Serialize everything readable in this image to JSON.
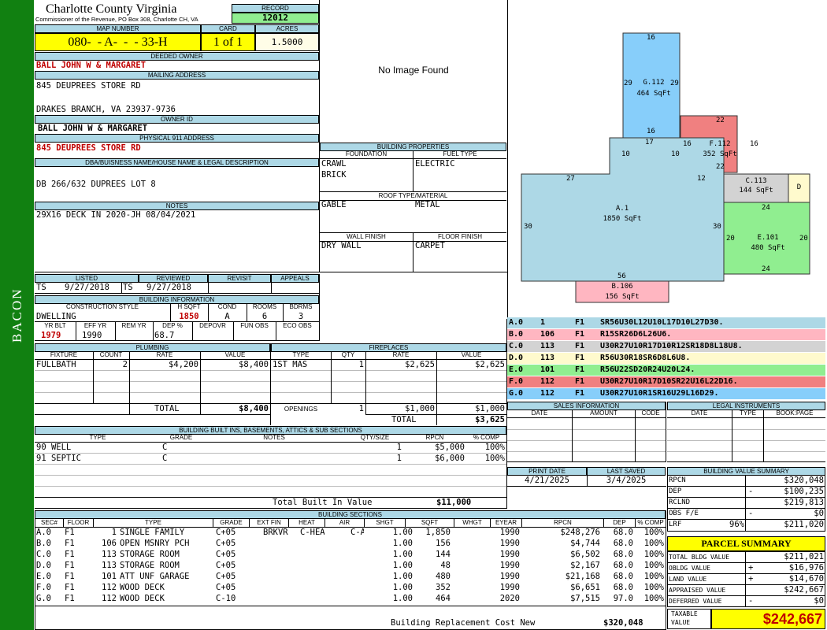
{
  "sidebar": {
    "label": "BACON"
  },
  "header": {
    "county": "Charlotte County Virginia",
    "commissioner": "Commissioner of the Revenue, PO Box 308, Charlotte CH, VA",
    "record_label": "RECORD",
    "record": "12012",
    "map_label": "MAP NUMBER",
    "map_number": "080-  - A-  -  - 33-H",
    "card_label": "CARD",
    "card": "1 of 1",
    "acres_label": "ACRES",
    "acres": "1.5000"
  },
  "owner": {
    "deeded_label": "DEEDED OWNER",
    "deeded": "BALL JOHN W & MARGARET",
    "mailing_label": "MAILING ADDRESS",
    "mail1": "845 DEUPREES STORE RD",
    "mail2": "DRAKES BRANCH, VA 23937-9736",
    "owner_id_label": "OWNER ID",
    "owner_id": "BALL JOHN W & MARGARET",
    "phys_label": "PHYSICAL 911 ADDRESS",
    "phys": "845 DEUPREES STORE RD",
    "dba_label": "DBA/BUISNESS NAME/HOUSE NAME & LEGAL DESCRIPTION",
    "dba": "DB 266/632 DUPREES LOT 8",
    "notes_label": "NOTES",
    "notes": "29X16 DECK IN 2020-JH 08/04/2021"
  },
  "image": {
    "no_image": "No Image Found"
  },
  "building_props": {
    "title": "BUILDING PROPERTIES",
    "foundation_label": "FOUNDATION",
    "fuel_label": "FUEL TYPE",
    "foundation1": "CRAWL",
    "foundation2": "BRICK",
    "fuel": "ELECTRIC",
    "roof_label": "ROOF TYPE/MATERIAL",
    "roof_type": "GABLE",
    "roof_material": "METAL",
    "wall_label": "WALL FINISH",
    "floor_label": "FLOOR FINISH",
    "wall": "DRY WALL",
    "floor": "CARPET"
  },
  "review": {
    "listed_label": "LISTED",
    "reviewed_label": "REVIEWED",
    "revisit_label": "REVISIT",
    "appeals_label": "APPEALS",
    "listed_by": "TS",
    "listed_date": "9/27/2018",
    "reviewed_by": "TS",
    "reviewed_date": "9/27/2018"
  },
  "building_info": {
    "title": "BUILDING INFORMATION",
    "style_label": "CONSTRUCTION STYLE",
    "hsqft_label": "H SQFT",
    "cond_label": "COND",
    "rooms_label": "ROOMS",
    "bdrms_label": "BDRMS",
    "style": "DWELLING",
    "hsqft": "1850",
    "cond": "A",
    "rooms": "6",
    "bdrms": "3",
    "yrblt_label": "YR BLT",
    "effyr_label": "EFF YR",
    "remyr_label": "REM YR",
    "dep_label": "DEP %",
    "depovr_label": "DEPOVR",
    "funobs_label": "FUN OBS",
    "ecoobs_label": "ECO OBS",
    "yrblt": "1979",
    "effyr": "1990",
    "dep": "68.7"
  },
  "plumbing": {
    "title": "PLUMBING",
    "fixture_label": "FIXTURE",
    "count_label": "COUNT",
    "rate_label": "RATE",
    "value_label": "VALUE",
    "fixture": "FULLBATH",
    "count": "2",
    "rate": "$4,200",
    "value": "$8,400",
    "total_label": "TOTAL",
    "total": "$8,400"
  },
  "fireplaces": {
    "title": "FIREPLACES",
    "type_label": "TYPE",
    "qty_label": "QTY",
    "rate_label": "RATE",
    "value_label": "VALUE",
    "type": "1ST MAS",
    "qty": "1",
    "rate": "$2,625",
    "value": "$2,625",
    "openings_label": "OPENINGS",
    "op_qty": "1",
    "op_rate": "$1,000",
    "op_value": "$1,000",
    "total_label": "TOTAL",
    "total": "$3,625"
  },
  "builtins": {
    "title": "BUILDING BUILT INS, BASEMENTS, ATTICS & SUB SECTIONS",
    "type_label": "TYPE",
    "grade_label": "GRADE",
    "notes_label": "NOTES",
    "qty_label": "QTY/SIZE",
    "rpcn_label": "RPCN",
    "comp_label": "% COMP",
    "rows": [
      {
        "type": "90 WELL",
        "grade": "C",
        "qty": "1",
        "rpcn": "$5,000",
        "comp": "100%"
      },
      {
        "type": "91 SEPTIC",
        "grade": "C",
        "qty": "1",
        "rpcn": "$6,000",
        "comp": "100%"
      }
    ],
    "total_label": "Total Built In Value",
    "total": "$11,000"
  },
  "sections": {
    "title": "BUILDING SECTIONS",
    "headers": [
      "SEC#",
      "FLOOR",
      "TYPE",
      "GRADE",
      "EXT FIN",
      "HEAT",
      "AIR",
      "SHGT",
      "SQFT",
      "WHGT",
      "EYEAR",
      "RPCN",
      "DEP",
      "% COMP"
    ],
    "rows": [
      {
        "sec": "A.0",
        "floor": "F1",
        "code": "1",
        "type": "SINGLE FAMILY",
        "grade": "C+05",
        "ext": "BRKVR",
        "heat": "C-HEAT",
        "air": "C-AIR",
        "shgt": "1.00",
        "sqft": "1,850",
        "eyear": "1990",
        "rpcn": "$248,276",
        "dep": "68.0",
        "comp": "100%"
      },
      {
        "sec": "B.0",
        "floor": "F1",
        "code": "106",
        "type": "OPEN MSNRY PCH",
        "grade": "C+05",
        "ext": "",
        "heat": "",
        "air": "",
        "shgt": "1.00",
        "sqft": "156",
        "eyear": "1990",
        "rpcn": "$4,744",
        "dep": "68.0",
        "comp": "100%"
      },
      {
        "sec": "C.0",
        "floor": "F1",
        "code": "113",
        "type": "STORAGE ROOM",
        "grade": "C+05",
        "ext": "",
        "heat": "",
        "air": "",
        "shgt": "1.00",
        "sqft": "144",
        "eyear": "1990",
        "rpcn": "$6,502",
        "dep": "68.0",
        "comp": "100%"
      },
      {
        "sec": "D.0",
        "floor": "F1",
        "code": "113",
        "type": "STORAGE ROOM",
        "grade": "C+05",
        "ext": "",
        "heat": "",
        "air": "",
        "shgt": "1.00",
        "sqft": "48",
        "eyear": "1990",
        "rpcn": "$2,167",
        "dep": "68.0",
        "comp": "100%"
      },
      {
        "sec": "E.0",
        "floor": "F1",
        "code": "101",
        "type": "ATT UNF GARAGE",
        "grade": "C+05",
        "ext": "",
        "heat": "",
        "air": "",
        "shgt": "1.00",
        "sqft": "480",
        "eyear": "1990",
        "rpcn": "$21,168",
        "dep": "68.0",
        "comp": "100%"
      },
      {
        "sec": "F.0",
        "floor": "F1",
        "code": "112",
        "type": "WOOD DECK",
        "grade": "C+05",
        "ext": "",
        "heat": "",
        "air": "",
        "shgt": "1.00",
        "sqft": "352",
        "eyear": "1990",
        "rpcn": "$6,651",
        "dep": "68.0",
        "comp": "100%"
      },
      {
        "sec": "G.0",
        "floor": "F1",
        "code": "112",
        "type": "WOOD DECK",
        "grade": "C-10",
        "ext": "",
        "heat": "",
        "air": "",
        "shgt": "1.00",
        "sqft": "464",
        "eyear": "2020",
        "rpcn": "$7,515",
        "dep": "97.0",
        "comp": "100%"
      }
    ],
    "total_label": "Building Replacement Cost New",
    "total": "$320,048"
  },
  "sketch": {
    "areas": [
      {
        "id": "G.112",
        "sqft": "464 SqFt",
        "color": "#87cefa"
      },
      {
        "id": "F.112",
        "sqft": "352 SqFt",
        "color": "#f08080"
      },
      {
        "id": "C.113",
        "sqft": "144 SqFt",
        "color": "#d3d3d3"
      },
      {
        "id": "D",
        "sqft": "",
        "color": "#fffacd"
      },
      {
        "id": "A.1",
        "sqft": "1850 SqFt",
        "color": "#add8e6"
      },
      {
        "id": "E.101",
        "sqft": "480 SqFt",
        "color": "#90ee90"
      },
      {
        "id": "B.106",
        "sqft": "156 SqFt",
        "color": "#ffb6c1"
      }
    ],
    "dims": {
      "g_top": "16",
      "g_left": "29",
      "g_right": "29",
      "g_bottom": "16",
      "f_top": "22",
      "f_left": "16",
      "f_right": "16",
      "f_bottom": "22",
      "a_top": "17",
      "a_l10": "10",
      "a_r10": "10",
      "a_27": "27",
      "a_12": "12",
      "a_left": "30",
      "a_right": "30",
      "a_bottom": "56",
      "e_top": "24",
      "e_left": "20",
      "e_right": "20",
      "e_bottom": "24"
    }
  },
  "sketch_legend": [
    {
      "sec": "A.0",
      "code": "1",
      "floor": "F1",
      "path": "SR56U30L12U10L17D10L27D30.",
      "color": "#add8e6"
    },
    {
      "sec": "B.0",
      "code": "106",
      "floor": "F1",
      "path": "R15SR26D6L26U6.",
      "color": "#ffb6c1"
    },
    {
      "sec": "C.0",
      "code": "113",
      "floor": "F1",
      "path": "U30R27U10R17D10R12SR18D8L18U8.",
      "color": "#d3d3d3"
    },
    {
      "sec": "D.0",
      "code": "113",
      "floor": "F1",
      "path": "R56U30R18SR6D8L6U8.",
      "color": "#fffacd"
    },
    {
      "sec": "E.0",
      "code": "101",
      "floor": "F1",
      "path": "R56U22SD20R24U20L24.",
      "color": "#90ee90"
    },
    {
      "sec": "F.0",
      "code": "112",
      "floor": "F1",
      "path": "U30R27U10R17D10SR22U16L22D16.",
      "color": "#f08080"
    },
    {
      "sec": "G.0",
      "code": "112",
      "floor": "F1",
      "path": "U30R27U10R1SR16U29L16D29.",
      "color": "#87cefa"
    }
  ],
  "sales": {
    "title": "SALES INFORMATION",
    "date_label": "DATE",
    "amount_label": "AMOUNT",
    "code_label": "CODE"
  },
  "legal": {
    "title": "LEGAL INSTRUMENTS",
    "date_label": "DATE",
    "type_label": "TYPE",
    "book_label": "BOOK:PAGE"
  },
  "print": {
    "print_label": "PRINT DATE",
    "saved_label": "LAST SAVED",
    "print_date": "4/21/2025",
    "saved_date": "3/4/2025"
  },
  "value_summary": {
    "title": "BUILDING VALUE SUMMARY",
    "rpcn_label": "RPCN",
    "rpcn": "$320,048",
    "dep_label": "DEP",
    "dep_sign": "-",
    "dep": "$100,235",
    "rclnd_label": "RCLND",
    "rclnd": "$219,813",
    "obs_label": "OBS F/E",
    "obs_sign": "-",
    "obs": "$0",
    "lrf_label": "LRF",
    "lrf_pct": "96%",
    "lrf": "$211,020"
  },
  "parcel": {
    "title": "PARCEL SUMMARY",
    "bldg_label": "TOTAL BLDG VALUE",
    "bldg": "$211,021",
    "obldg_label": "OBLDG VALUE",
    "obldg_sign": "+",
    "obldg": "$16,976",
    "land_label": "LAND VALUE",
    "land_sign": "+",
    "land": "$14,670",
    "appraised_label": "APPRAISED VALUE",
    "appraised": "$242,667",
    "deferred_label": "DEFERRED VALUE",
    "deferred_sign": "-",
    "deferred": "$0",
    "taxable_label1": "TAXABLE",
    "taxable_label2": "VALUE",
    "taxable": "$242,667"
  }
}
